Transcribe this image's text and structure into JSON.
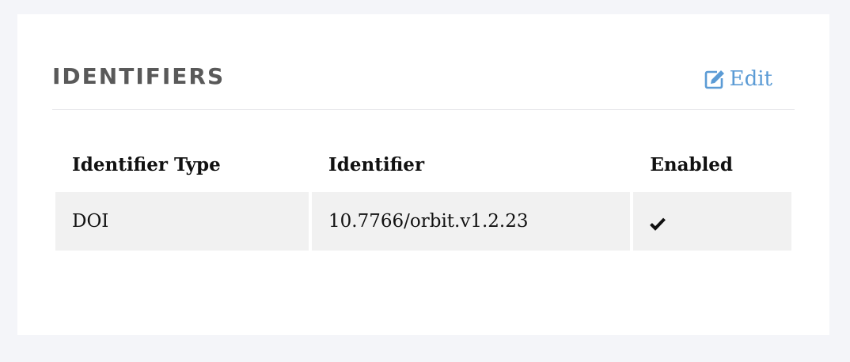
{
  "section": {
    "title": "IDENTIFIERS",
    "edit_label": "Edit"
  },
  "table": {
    "headers": [
      "Identifier Type",
      "Identifier",
      "Enabled"
    ],
    "rows": [
      {
        "type": "DOI",
        "identifier": "10.7766/orbit.v1.2.23",
        "enabled_icon": "check-icon"
      }
    ]
  },
  "colors": {
    "accent": "#5b9bd5",
    "title": "#595959",
    "cell_bg": "#f1f1f1",
    "page_bg": "#f4f5f9"
  }
}
